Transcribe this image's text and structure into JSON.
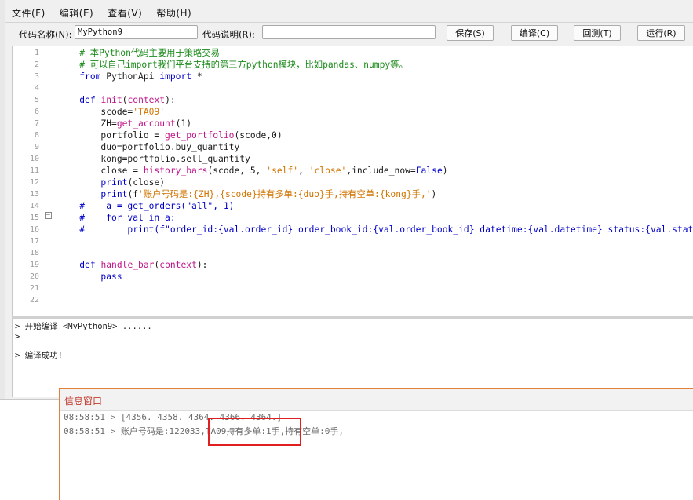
{
  "menubar": {
    "items": [
      "文件(F)",
      "编辑(E)",
      "查看(V)",
      "帮助(H)"
    ]
  },
  "toolbar": {
    "code_name_label": "代码名称(N):",
    "code_name_value": "MyPython9",
    "code_desc_label": "代码说明(R):",
    "code_desc_value": "",
    "save_label": "保存(S)",
    "compile_label": "编译(C)",
    "backtest_label": "回测(T)",
    "run_label": "运行(R)"
  },
  "editor": {
    "line_numbers": [
      "1",
      "2",
      "3",
      "4",
      "5",
      "6",
      "7",
      "8",
      "9",
      "10",
      "11",
      "12",
      "13",
      "14",
      "15",
      "16",
      "17",
      "18",
      "19",
      "20",
      "21",
      "22"
    ]
  },
  "code_lines": [
    "    # 本Python代码主要用于策略交易",
    "    # 可以自己import我们平台支持的第三方python模块，比如pandas、numpy等。",
    "    from PythonApi import *",
    "",
    "    def init(context):",
    "        scode='TA09'",
    "        ZH=get_account(1)",
    "        portfolio = get_portfolio(scode,0)",
    "        duo=portfolio.buy_quantity",
    "        kong=portfolio.sell_quantity",
    "        close = history_bars(scode, 5, 'self', 'close',include_now=False)",
    "        print(close)",
    "        print(f'账户号码是:{ZH},{scode}持有多单:{duo}手,持有空单:{kong}手,')",
    "    #    a = get_orders(\"all\", 1)",
    "    #    for val in a:",
    "    #        print(f\"order_id:{val.order_id} order_book_id:{val.order_book_id} datetime:{val.datetime} status:{val.status",
    "",
    "",
    "    def handle_bar(context):",
    "        pass",
    "",
    ""
  ],
  "output": {
    "lines": [
      "> 开始编译 <MyPython9> ......",
      ">",
      "",
      "> 编译成功!"
    ]
  },
  "info_window": {
    "title": "信息窗口",
    "lines": [
      "08:58:51 > [4356. 4358. 4364. 4366. 4364.]",
      "08:58:51 > 账户号码是:122033,TA09持有多单:1手,持有空单:0手,"
    ]
  },
  "colors": {
    "keyword": "#0000c8",
    "function": "#c0148a",
    "string": "#d17400",
    "comment": "#1a8a1a",
    "info_border": "#e0803a",
    "highlight_box": "#e02020"
  }
}
